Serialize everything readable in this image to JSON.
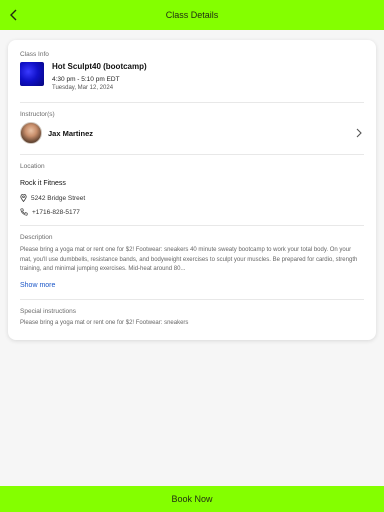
{
  "header": {
    "title": "Class Details",
    "back_icon": "chevron-left-icon",
    "accent_color": "#84ff00"
  },
  "class_info": {
    "section_label": "Class Info",
    "name": "Hot Sculpt40 (bootcamp)",
    "time": "4:30 pm - 5:10 pm EDT",
    "date": "Tuesday, Mar 12, 2024"
  },
  "instructors": {
    "section_label": "Instructor(s)",
    "name": "Jax Martinez"
  },
  "location": {
    "section_label": "Location",
    "name": "Rock it Fitness",
    "address": "5242 Bridge Street",
    "phone": "+1716-828-5177"
  },
  "description": {
    "section_label": "Description",
    "text": "Please bring a yoga mat or rent one for $2! Footwear: sneakers 40 minute sweaty bootcamp to work your total body. On your mat, you'll use dumbbells, resistance bands, and bodyweight exercises to sculpt your muscles. Be prepared for cardio, strength training, and minimal jumping exercises. Mid-heat around 80...",
    "show_more_label": "Show more"
  },
  "special_instructions": {
    "section_label": "Special instructions",
    "text": "Please bring a yoga mat or rent one for $2! Footwear: sneakers"
  },
  "footer": {
    "book_label": "Book Now"
  }
}
